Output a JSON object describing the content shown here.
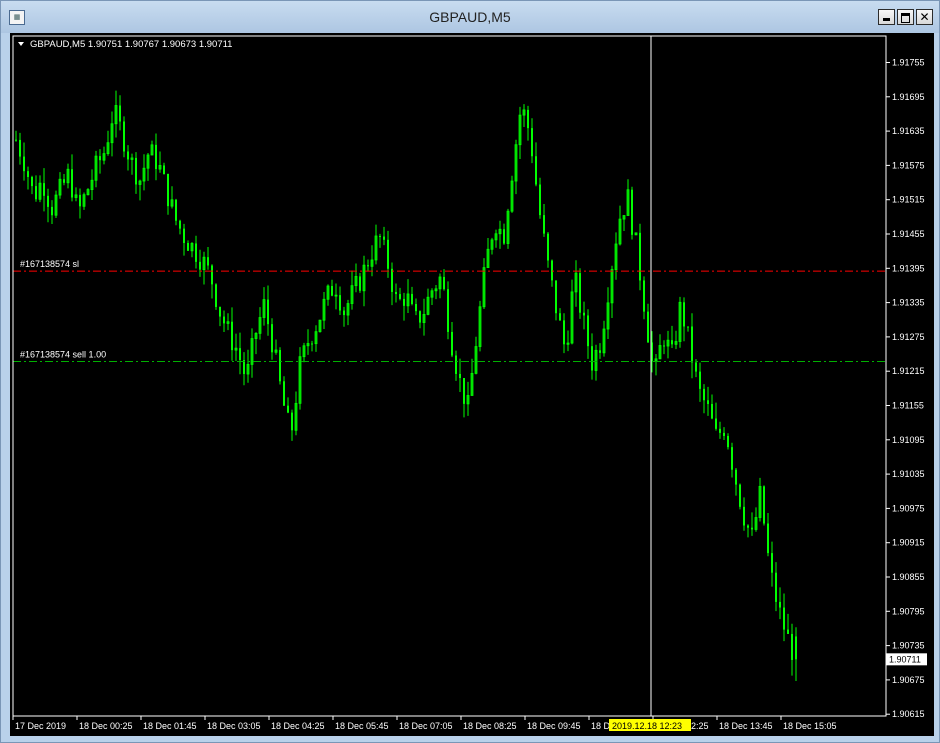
{
  "window": {
    "title": "GBPAUD,M5"
  },
  "header": {
    "symbol_line": "GBPAUD,M5  1.90751 1.90767 1.90673 1.90711"
  },
  "colors": {
    "candle": "#00ff00",
    "axis": "#ffffff",
    "sl_line": "#ff0000",
    "order_line": "#00b000",
    "crosshair": "#ffffff",
    "price_tag_bg": "#ffffff",
    "date_tag_bg": "#ffff00"
  },
  "orders": [
    {
      "label": "#167138574 sl",
      "price": 1.9139
    },
    {
      "label": "#167138574 sell 1.00",
      "price": 1.91232
    }
  ],
  "current_price": {
    "value": 1.90711,
    "label": "1.90711"
  },
  "crosshair": {
    "label": "2019.12.18 12:23"
  },
  "chart_data": {
    "type": "candlestick",
    "symbol": "GBPAUD",
    "timeframe": "M5",
    "y_ticks": [
      "1.91755",
      "1.91695",
      "1.91635",
      "1.91575",
      "1.91515",
      "1.91455",
      "1.91395",
      "1.91335",
      "1.91275",
      "1.91215",
      "1.91155",
      "1.91095",
      "1.91035",
      "1.90975",
      "1.90915",
      "1.90855",
      "1.90795",
      "1.90735",
      "1.90675",
      "1.90615"
    ],
    "x_ticks": [
      "17 Dec 2019",
      "18 Dec 00:25",
      "18 Dec 01:45",
      "18 Dec 03:05",
      "18 Dec 04:25",
      "18 Dec 05:45",
      "18 Dec 07:05",
      "18 Dec 08:25",
      "18 Dec 09:45",
      "18 Dec 11:05",
      "18 Dec 12:25",
      "18 Dec 13:45",
      "18 Dec 15:05"
    ],
    "ylim": [
      1.90615,
      1.91795
    ],
    "last": {
      "open": 1.90751,
      "high": 1.90767,
      "low": 1.90673,
      "close": 1.90711
    },
    "close_path": [
      1.9162,
      1.9158,
      1.9152,
      1.9155,
      1.915,
      1.9153,
      1.9156,
      1.9149,
      1.9153,
      1.9157,
      1.916,
      1.9167,
      1.9163,
      1.9158,
      1.9155,
      1.916,
      1.9158,
      1.9153,
      1.9148,
      1.9145,
      1.9143,
      1.9141,
      1.9138,
      1.9132,
      1.9128,
      1.9125,
      1.912,
      1.9128,
      1.9133,
      1.9126,
      1.9117,
      1.911,
      1.9122,
      1.9127,
      1.913,
      1.9134,
      1.9137,
      1.9132,
      1.9135,
      1.9138,
      1.9142,
      1.9145,
      1.914,
      1.9133,
      1.9135,
      1.913,
      1.9132,
      1.9136,
      1.9138,
      1.9128,
      1.912,
      1.9115,
      1.9128,
      1.914,
      1.9148,
      1.9145,
      1.9157,
      1.9168,
      1.9163,
      1.915,
      1.914,
      1.9132,
      1.9125,
      1.9138,
      1.913,
      1.9123,
      1.9127,
      1.9138,
      1.9148,
      1.9152,
      1.9143,
      1.9132,
      1.912,
      1.9128,
      1.9124,
      1.9133,
      1.9126,
      1.9118,
      1.9115,
      1.911,
      1.9112,
      1.9104,
      1.9097,
      1.9092,
      1.91,
      1.9087,
      1.908,
      1.9075,
      1.9071
    ]
  }
}
